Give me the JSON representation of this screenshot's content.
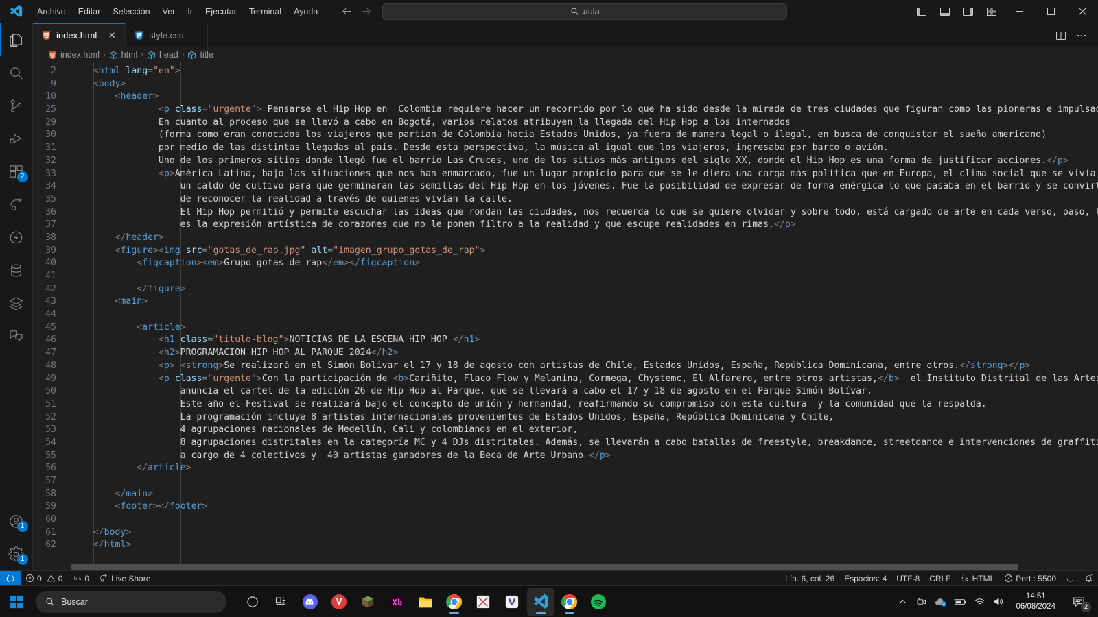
{
  "titlebar": {
    "logo_icon": "vscode-logo-icon",
    "menu": [
      {
        "label": "Archivo"
      },
      {
        "label": "Editar"
      },
      {
        "label": "Selección"
      },
      {
        "label": "Ver"
      },
      {
        "label": "Ir"
      },
      {
        "label": "Ejecutar"
      },
      {
        "label": "Terminal"
      },
      {
        "label": "Ayuda"
      }
    ],
    "nav_back_icon": "arrow-left-icon",
    "nav_forward_icon": "arrow-right-icon",
    "command_center": {
      "value": "aula",
      "search_icon": "search-icon"
    },
    "layout_icons": [
      "toggle-primary-sidebar-icon",
      "toggle-panel-icon",
      "toggle-secondary-sidebar-icon",
      "customize-layout-icon"
    ],
    "window_controls": {
      "minimize": "minimize-icon",
      "maximize": "maximize-icon",
      "close": "close-icon"
    }
  },
  "activitybar": {
    "items": [
      {
        "name": "explorer",
        "icon": "files-icon",
        "badge": ""
      },
      {
        "name": "search",
        "icon": "search-icon",
        "badge": ""
      },
      {
        "name": "source-control",
        "icon": "source-control-icon",
        "badge": ""
      },
      {
        "name": "run-and-debug",
        "icon": "run-debug-icon",
        "badge": ""
      },
      {
        "name": "extensions",
        "icon": "extensions-icon",
        "badge": "2"
      },
      {
        "name": "live-share",
        "icon": "share-icon",
        "badge": ""
      },
      {
        "name": "thunder-client",
        "icon": "thunder-icon",
        "badge": ""
      },
      {
        "name": "database",
        "icon": "database-icon",
        "badge": ""
      },
      {
        "name": "layers",
        "icon": "layers-icon",
        "badge": ""
      },
      {
        "name": "remote-explorer",
        "icon": "comment-icon",
        "badge": ""
      }
    ],
    "bottom": [
      {
        "name": "accounts",
        "icon": "account-icon",
        "badge": "1"
      },
      {
        "name": "manage",
        "icon": "gear-icon",
        "badge": "1"
      }
    ]
  },
  "tabs": [
    {
      "label": "index.html",
      "icon": "html5-icon",
      "active": true,
      "close_icon": "close-icon"
    },
    {
      "label": "style.css",
      "icon": "css3-icon",
      "active": false,
      "close_icon": "close-icon"
    }
  ],
  "tab_actions": [
    {
      "name": "split-editor",
      "icon": "split-editor-icon"
    },
    {
      "name": "more-actions",
      "icon": "ellipsis-icon"
    }
  ],
  "breadcrumb": {
    "file_icon": "html5-icon",
    "items": [
      {
        "label": "index.html",
        "icon": "html5-icon"
      },
      {
        "label": "html",
        "icon": "symbol-field-icon"
      },
      {
        "label": "head",
        "icon": "symbol-field-icon"
      },
      {
        "label": "title",
        "icon": "symbol-field-icon"
      }
    ],
    "separator": "›"
  },
  "code": {
    "lines": [
      {
        "num": "2",
        "indent": 1,
        "html": "<span class=\"brk\">&lt;</span><span class=\"tag\">html</span> <span class=\"attr\">lang</span><span class=\"brk\">=</span><span class=\"str\">\"en\"</span><span class=\"brk\">&gt;</span>"
      },
      {
        "num": "9",
        "indent": 1,
        "html": "<span class=\"brk\">&lt;</span><span class=\"tag\">body</span><span class=\"brk\">&gt;</span>"
      },
      {
        "num": "10",
        "indent": 2,
        "html": "<span class=\"brk\">&lt;</span><span class=\"tag\">header</span><span class=\"brk\">&gt;</span>"
      },
      {
        "num": "25",
        "indent": 4,
        "html": "<span class=\"brk\">&lt;</span><span class=\"tag\">p</span> <span class=\"attr\">class</span><span class=\"brk\">=</span><span class=\"str\">\"urgente\"</span><span class=\"brk\">&gt;</span><span class=\"txt\"> Pensarse el Hip Hop en  Colombia requiere hacer un recorrido por lo que ha sido desde la mirada de tres ciudades que figuran como las pioneras e impulsadoras por medio de las cuales</span>"
      },
      {
        "num": "29",
        "indent": 4,
        "html": "<span class=\"txt\">En cuanto al proceso que se llevó a cabo en Bogotá, varios relatos atribuyen la llegada del Hip Hop a los internados</span>"
      },
      {
        "num": "30",
        "indent": 4,
        "html": "<span class=\"txt\">(forma como eran conocidos los viajeros que partían de Colombia hacia Estados Unidos, ya fuera de manera legal o ilegal, en busca de conquistar el sueño americano)</span>"
      },
      {
        "num": "31",
        "indent": 4,
        "html": "<span class=\"txt\">por medio de las distintas llegadas al país. Desde esta perspectiva, la música al igual que los viajeros, ingresaba por barco o avión.</span>"
      },
      {
        "num": "32",
        "indent": 4,
        "html": "<span class=\"txt\">Uno de los primeros sitios donde llegó fue el barrio Las Cruces, uno de los sitios más antiguos del siglo XX, donde el Hip Hop es una forma de justificar acciones.</span><span class=\"brk\">&lt;/</span><span class=\"tag\">p</span><span class=\"brk\">&gt;</span>"
      },
      {
        "num": "33",
        "indent": 4,
        "html": "<span class=\"brk\">&lt;</span><span class=\"tag\">p</span><span class=\"brk\">&gt;</span><span class=\"txt\">América Latina, bajo las situaciones que nos han enmarcado, fue un lugar propicio para que se le diera una carga más política que en Europa, el clima social que se vivía entonces fue</span>"
      },
      {
        "num": "34",
        "indent": 5,
        "html": "<span class=\"txt\">un caldo de cultivo para que germinaran las semillas del Hip Hop en los jóvenes. Fue la posibilidad de expresar de forma enérgica lo que pasaba en el barrio y se convirtió en una forma</span>"
      },
      {
        "num": "35",
        "indent": 5,
        "html": "<span class=\"txt\">de reconocer la realidad a través de quienes vivían la calle.</span>"
      },
      {
        "num": "36",
        "indent": 5,
        "html": "<span class=\"txt\">El Hip Hop permitió y permite escuchar las ideas que rondan las ciudades, nos recuerda lo que se quiere olvidar y sobre todo, está cargado de arte en cada verso, paso, línea o mural,</span>"
      },
      {
        "num": "37",
        "indent": 5,
        "html": "<span class=\"txt\">es la expresión artística de corazones que no le ponen filtro a la realidad y que escupe realidades en rimas.</span><span class=\"brk\">&lt;/</span><span class=\"tag\">p</span><span class=\"brk\">&gt;</span>"
      },
      {
        "num": "38",
        "indent": 2,
        "html": "<span class=\"brk\">&lt;/</span><span class=\"tag\">header</span><span class=\"brk\">&gt;</span>"
      },
      {
        "num": "39",
        "indent": 2,
        "html": "<span class=\"brk\">&lt;</span><span class=\"tag\">figure</span><span class=\"brk\">&gt;&lt;</span><span class=\"tag\">img</span> <span class=\"attr\">src</span><span class=\"brk\">=</span><span class=\"str\">\"</span><span class=\"lnk\">gotas_de_rap.jpg</span><span class=\"str\">\"</span> <span class=\"attr\">alt</span><span class=\"brk\">=</span><span class=\"str\">\"imagen_grupo_gotas_de_rap\"</span><span class=\"brk\">&gt;</span>"
      },
      {
        "num": "40",
        "indent": 3,
        "html": "<span class=\"brk\">&lt;</span><span class=\"tag\">figcaption</span><span class=\"brk\">&gt;&lt;</span><span class=\"tag\">em</span><span class=\"brk\">&gt;</span><span class=\"txt\">Grupo gotas de rap</span><span class=\"brk\">&lt;/</span><span class=\"tag\">em</span><span class=\"brk\">&gt;&lt;/</span><span class=\"tag\">figcaption</span><span class=\"brk\">&gt;</span>"
      },
      {
        "num": "41",
        "indent": 3,
        "html": ""
      },
      {
        "num": "42",
        "indent": 3,
        "html": "<span class=\"brk\">&lt;/</span><span class=\"tag\">figure</span><span class=\"brk\">&gt;</span>"
      },
      {
        "num": "43",
        "indent": 2,
        "html": "<span class=\"brk\">&lt;</span><span class=\"tag\">main</span><span class=\"brk\">&gt;</span>"
      },
      {
        "num": "44",
        "indent": 3,
        "html": ""
      },
      {
        "num": "45",
        "indent": 3,
        "html": "<span class=\"brk\">&lt;</span><span class=\"tag\">article</span><span class=\"brk\">&gt;</span>"
      },
      {
        "num": "46",
        "indent": 4,
        "html": "<span class=\"brk\">&lt;</span><span class=\"tag\">h1</span> <span class=\"attr\">class</span><span class=\"brk\">=</span><span class=\"str\">\"titulo-blog\"</span><span class=\"brk\">&gt;</span><span class=\"txt\">NOTICIAS DE LA ESCENA HIP HOP </span><span class=\"brk\">&lt;/</span><span class=\"tag\">h1</span><span class=\"brk\">&gt;</span>"
      },
      {
        "num": "47",
        "indent": 4,
        "html": "<span class=\"brk\">&lt;</span><span class=\"tag\">h2</span><span class=\"brk\">&gt;</span><span class=\"txt\">PROGRAMACION HIP HOP AL PARQUE 2024</span><span class=\"brk\">&lt;/</span><span class=\"tag\">h2</span><span class=\"brk\">&gt;</span>"
      },
      {
        "num": "48",
        "indent": 4,
        "html": "<span class=\"brk\">&lt;</span><span class=\"tag\">p</span><span class=\"brk\">&gt;</span> <span class=\"brk\">&lt;</span><span class=\"tag\">strong</span><span class=\"brk\">&gt;</span><span class=\"txt\">Se realizará en el Simón Bolívar el 17 y 18 de agosto con artistas de Chile, Estados Unidos, España, República Dominicana, entre otros.</span><span class=\"brk\">&lt;/</span><span class=\"tag\">strong</span><span class=\"brk\">&gt;&lt;/</span><span class=\"tag\">p</span><span class=\"brk\">&gt;</span>"
      },
      {
        "num": "49",
        "indent": 4,
        "html": "<span class=\"brk\">&lt;</span><span class=\"tag\">p</span> <span class=\"attr\">class</span><span class=\"brk\">=</span><span class=\"str\">\"urgente\"</span><span class=\"brk\">&gt;</span><span class=\"txt\">Con la participación de </span><span class=\"brk\">&lt;</span><span class=\"tag\">b</span><span class=\"brk\">&gt;</span><span class=\"txt\">Cariñito, Flaco Flow y Melanina, Cormega, Chystemc, El Alfarero, entre otros artistas,</span><span class=\"brk\">&lt;/</span><span class=\"tag\">b</span><span class=\"brk\">&gt;</span><span class=\"txt\">  el Instituto Distrital de las Artes - Idartes</span>"
      },
      {
        "num": "50",
        "indent": 5,
        "html": "<span class=\"txt\">anuncia el cartel de la edición 26 de Hip Hop al Parque, que se llevará a cabo el 17 y 18 de agosto en el Parque Simón Bolívar.</span>"
      },
      {
        "num": "51",
        "indent": 5,
        "html": "<span class=\"txt\">Este año el Festival se realizará bajo el concepto de unión y hermandad, reafirmando su compromiso con esta cultura  y la comunidad que la respalda.</span>"
      },
      {
        "num": "52",
        "indent": 5,
        "html": "<span class=\"txt\">La programación incluye 8 artistas internacionales provenientes de Estados Unidos, España, República Dominicana y Chile,</span>"
      },
      {
        "num": "53",
        "indent": 5,
        "html": "<span class=\"txt\">4 agrupaciones nacionales de Medellín, Cali y colombianos en el exterior,</span>"
      },
      {
        "num": "54",
        "indent": 5,
        "html": "<span class=\"txt\">8 agrupaciones distritales en la categoría MC y 4 DJs distritales. Además, se llevarán a cabo batallas de freestyle, breakdance, streetdance e intervenciones de graffiti</span>"
      },
      {
        "num": "55",
        "indent": 5,
        "html": "<span class=\"txt\">a cargo de 4 colectivos y  40 artistas ganadores de la Beca de Arte Urbano </span><span class=\"brk\">&lt;/</span><span class=\"tag\">p</span><span class=\"brk\">&gt;</span>"
      },
      {
        "num": "56",
        "indent": 3,
        "html": "<span class=\"brk\">&lt;/</span><span class=\"tag\">article</span><span class=\"brk\">&gt;</span>"
      },
      {
        "num": "57",
        "indent": 3,
        "html": ""
      },
      {
        "num": "58",
        "indent": 2,
        "html": "<span class=\"brk\">&lt;/</span><span class=\"tag\">main</span><span class=\"brk\">&gt;</span>"
      },
      {
        "num": "59",
        "indent": 2,
        "html": "<span class=\"brk\">&lt;</span><span class=\"tag\">footer</span><span class=\"brk\">&gt;&lt;/</span><span class=\"tag\">footer</span><span class=\"brk\">&gt;</span>"
      },
      {
        "num": "60",
        "indent": 2,
        "html": ""
      },
      {
        "num": "61",
        "indent": 1,
        "html": "<span class=\"brk\">&lt;/</span><span class=\"tag\">body</span><span class=\"brk\">&gt;</span>"
      },
      {
        "num": "62",
        "indent": 1,
        "html": "<span class=\"brk\">&lt;/</span><span class=\"tag\">html</span><span class=\"brk\">&gt;</span>"
      }
    ],
    "right_edge_fragment": "ri"
  },
  "statusbar": {
    "remote_icon": "remote-window-icon",
    "left": [
      {
        "name": "problems",
        "icon": "error-warning-icon",
        "label": "0  0",
        "errors": "0",
        "warnings": "0"
      },
      {
        "name": "ports",
        "icon": "ports-icon",
        "label": "0"
      },
      {
        "name": "live-share",
        "icon": "live-share-icon",
        "label": "Live Share"
      }
    ],
    "right": [
      {
        "name": "cursor-position",
        "label": "Lín. 6, col. 26"
      },
      {
        "name": "indentation",
        "label": "Espacios: 4"
      },
      {
        "name": "encoding",
        "label": "UTF-8"
      },
      {
        "name": "eol",
        "label": "CRLF"
      },
      {
        "name": "language-mode",
        "icon": "braces-icon",
        "label": "HTML"
      },
      {
        "name": "live-server-port",
        "icon": "circle-slash-icon",
        "label": "Port : 5500"
      },
      {
        "name": "spinner",
        "icon": "loading-icon",
        "label": ""
      },
      {
        "name": "notifications",
        "icon": "bell-icon",
        "label": ""
      }
    ]
  },
  "taskbar": {
    "start_icon": "windows-start-icon",
    "search": {
      "placeholder": "Buscar",
      "icon": "search-icon"
    },
    "apps": [
      {
        "name": "cortana",
        "icon": "circle-icon"
      },
      {
        "name": "task-view",
        "icon": "task-view-icon"
      },
      {
        "name": "discord",
        "icon": "discord-icon"
      },
      {
        "name": "app-red",
        "icon": "red-app-icon"
      },
      {
        "name": "minecraft",
        "icon": "minecraft-icon"
      },
      {
        "name": "xd",
        "icon": "adobe-xd-icon"
      },
      {
        "name": "file-explorer",
        "icon": "folder-icon"
      },
      {
        "name": "chrome",
        "icon": "chrome-icon"
      },
      {
        "name": "excel-alt",
        "icon": "grid-app-icon"
      },
      {
        "name": "vlc-alt",
        "icon": "v-app-icon"
      },
      {
        "name": "vscode",
        "icon": "vscode-logo-icon"
      },
      {
        "name": "chrome-window",
        "icon": "chrome-icon"
      },
      {
        "name": "spotify",
        "icon": "spotify-icon"
      }
    ],
    "tray": [
      {
        "name": "show-hidden-icons",
        "icon": "chevron-up-icon"
      },
      {
        "name": "camera",
        "icon": "camera-icon"
      },
      {
        "name": "onedrive",
        "icon": "cloud-icon"
      },
      {
        "name": "battery",
        "icon": "battery-icon"
      },
      {
        "name": "network",
        "icon": "wifi-icon"
      },
      {
        "name": "volume",
        "icon": "speaker-icon"
      }
    ],
    "clock": {
      "time": "14:51",
      "date": "06/08/2024"
    },
    "notifications": {
      "icon": "notification-icon",
      "count": "2"
    }
  },
  "colors": {
    "accent": "#0078d4",
    "tag": "#569cd6",
    "string": "#ce9178",
    "attribute": "#9cdcfe",
    "editor_bg": "#1f1f1f",
    "chrome_bg": "#181818"
  }
}
